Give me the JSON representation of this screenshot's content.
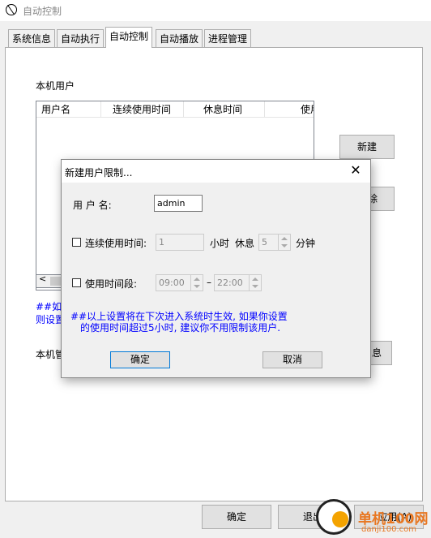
{
  "window": {
    "title": "自动控制"
  },
  "tabs": [
    "系统信息",
    "自动执行",
    "自动控制",
    "自动播放",
    "进程管理"
  ],
  "panel": {
    "local_user_label": "本机用户",
    "columns": [
      "用户名",
      "连续使用时间",
      "休息时间",
      "使用"
    ],
    "new_button": "新建",
    "delete_button": "除",
    "note_partial": "##如果\n则设置",
    "local_mgr_label": "本机管",
    "info_button": "息"
  },
  "footer": {
    "ok_button": "确定",
    "exit_button": "退出",
    "apply_button": "应用(A)"
  },
  "dialog": {
    "title": "新建用户限制...",
    "username_label": "用  户  名:",
    "username_value": "admin",
    "continuous_label": "连续使用时间:",
    "continuous_value": "1",
    "hours_label": "小时",
    "rest_label": "休息",
    "rest_value": "5",
    "minutes_label": "分钟",
    "period_label": "使用时间段:",
    "period_start": "09:00",
    "period_dash": "–",
    "period_end": "22:00",
    "note_line1": "##以上设置将在下次进入系统时生效, 如果你设置",
    "note_line2": "的使用时间超过5小时, 建议你不用限制该用户.",
    "ok_button": "确定",
    "cancel_button": "取消"
  },
  "watermark": {
    "name": "单机100网",
    "url": "danji100.com"
  }
}
